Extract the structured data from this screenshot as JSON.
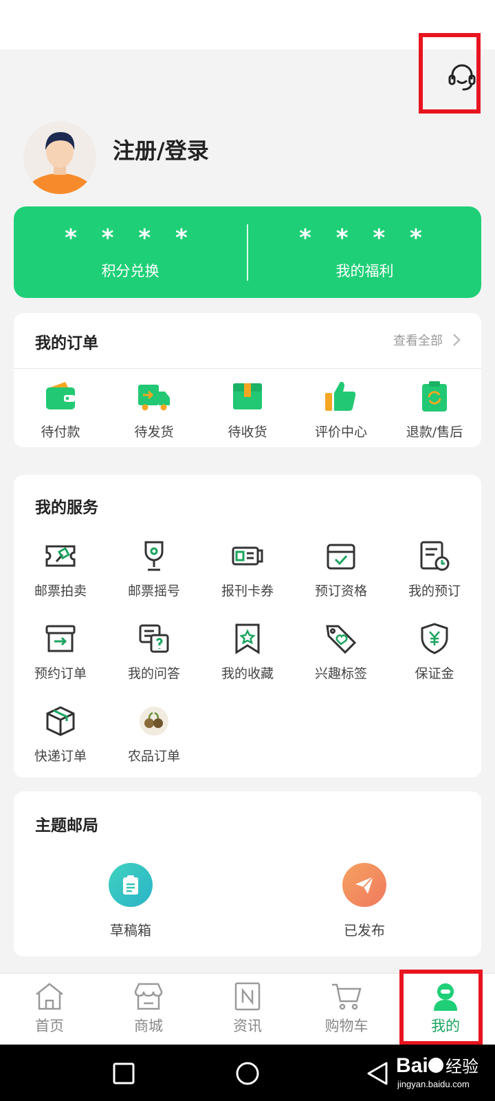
{
  "profile": {
    "login_label": "注册/登录"
  },
  "points": [
    {
      "value": "* * * *",
      "label": "积分兑换"
    },
    {
      "value": "* * * *",
      "label": "我的福利"
    }
  ],
  "orders": {
    "title": "我的订单",
    "view_all": "查看全部",
    "items": [
      {
        "label": "待付款",
        "icon": "wallet-icon"
      },
      {
        "label": "待发货",
        "icon": "delivery-truck-icon"
      },
      {
        "label": "待收货",
        "icon": "package-box-icon"
      },
      {
        "label": "评价中心",
        "icon": "thumbs-up-icon"
      },
      {
        "label": "退款/售后",
        "icon": "refund-icon"
      }
    ]
  },
  "services": {
    "title": "我的服务",
    "items": [
      {
        "label": "邮票拍卖",
        "icon": "auction-hammer-icon"
      },
      {
        "label": "邮票摇号",
        "icon": "trophy-icon"
      },
      {
        "label": "报刊卡券",
        "icon": "card-ticket-icon"
      },
      {
        "label": "预订资格",
        "icon": "calendar-check-icon"
      },
      {
        "label": "我的预订",
        "icon": "document-clock-icon"
      },
      {
        "label": "预约订单",
        "icon": "inbox-arrow-icon"
      },
      {
        "label": "我的问答",
        "icon": "question-chat-icon"
      },
      {
        "label": "我的收藏",
        "icon": "bookmark-star-icon"
      },
      {
        "label": "兴趣标签",
        "icon": "tag-heart-icon"
      },
      {
        "label": "保证金",
        "icon": "shield-yen-icon"
      },
      {
        "label": "快递订单",
        "icon": "parcel-cube-icon"
      },
      {
        "label": "农品订单",
        "icon": "fruit-icon"
      }
    ]
  },
  "theme_post": {
    "title": "主题邮局",
    "items": [
      {
        "label": "草稿箱",
        "icon": "clipboard-icon",
        "color": "#33c4b6"
      },
      {
        "label": "已发布",
        "icon": "paper-plane-icon",
        "color": "#f29060"
      }
    ]
  },
  "tabs": [
    {
      "label": "首页",
      "icon": "home-icon",
      "active": false
    },
    {
      "label": "商城",
      "icon": "store-icon",
      "active": false
    },
    {
      "label": "资讯",
      "icon": "news-icon",
      "active": false
    },
    {
      "label": "购物车",
      "icon": "cart-icon",
      "active": false
    },
    {
      "label": "我的",
      "icon": "user-icon",
      "active": true
    }
  ],
  "colors": {
    "brand_green": "#1fcf77",
    "active_tab": "#1aa45f",
    "highlight_red": "#e8141f"
  },
  "watermark": "Bai 经验 jingyan.baidu.com"
}
